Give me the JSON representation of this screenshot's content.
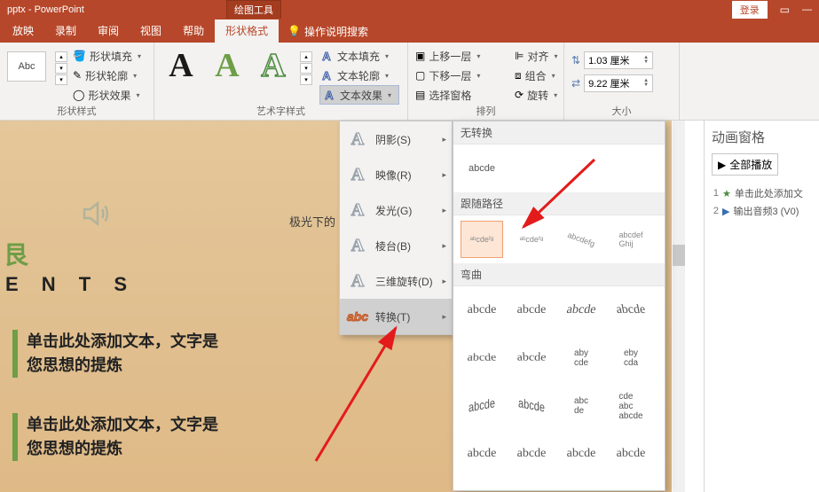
{
  "titlebar": {
    "title": "pptx - PowerPoint",
    "tool": "绘图工具",
    "login": "登录"
  },
  "tabs": {
    "items": [
      "放映",
      "录制",
      "审阅",
      "视图",
      "帮助",
      "形状格式"
    ],
    "active": 5,
    "tell": "操作说明搜索"
  },
  "ribbon": {
    "shape_styles_label": "形状样式",
    "shape_box": "Abc",
    "shape_fill": "形状填充",
    "shape_outline": "形状轮廓",
    "shape_fx": "形状效果",
    "wordart_label": "艺术字样式",
    "txt_fill": "文本填充",
    "txt_outline": "文本轮廓",
    "txt_fx": "文本效果",
    "arrange_label": "排列",
    "bring_forward": "上移一层",
    "send_backward": "下移一层",
    "selection_pane": "选择窗格",
    "align": "对齐",
    "group": "组合",
    "rotate": "旋转",
    "size_label": "大小",
    "height": "1.03 厘米",
    "width": "9.22 厘米"
  },
  "fx_menu": {
    "shadow": "阴影(S)",
    "reflection": "映像(R)",
    "glow": "发光(G)",
    "bevel": "棱台(B)",
    "rotate3d": "三维旋转(D)",
    "transform": "转换(T)"
  },
  "tf": {
    "no_transform": "无转换",
    "sample": "abcde",
    "follow_path": "跟随路径",
    "warp": "弯曲"
  },
  "slide": {
    "script": "极光下的",
    "letter": "艮",
    "ents": "E N T S",
    "block1a": "单击此处添加文本，文字是",
    "block1b": "您思想的提炼",
    "block2a": "单击此处添加文本，文字是",
    "block2b": "您思想的提炼"
  },
  "anim": {
    "title": "动画窗格",
    "play": "全部播放",
    "items": [
      {
        "n": "1",
        "icon": "star",
        "label": "单击此处添加文"
      },
      {
        "n": "2",
        "icon": "play",
        "label": "输出音频3 (V0)"
      }
    ]
  }
}
